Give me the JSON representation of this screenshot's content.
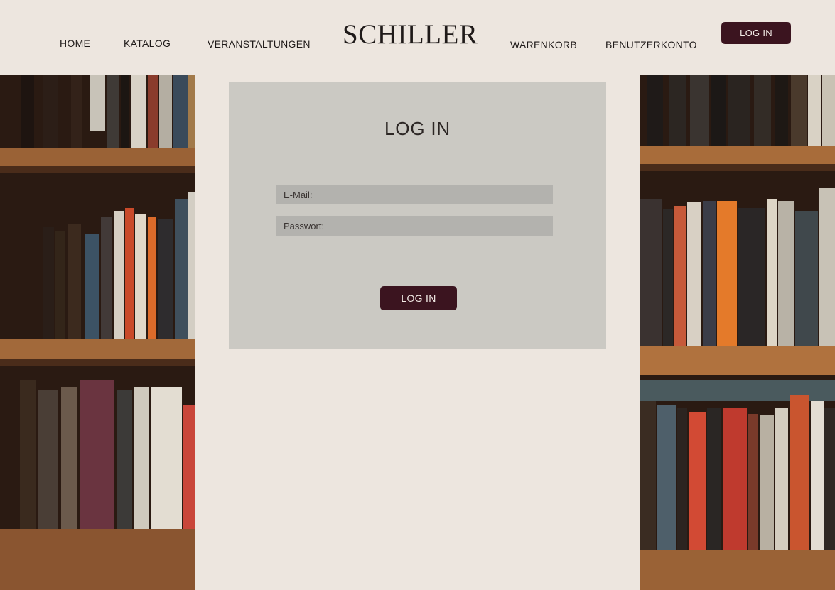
{
  "header": {
    "nav_left": [
      "HOME",
      "KATALOG",
      "VERANSTALTUNGEN"
    ],
    "logo": "SCHILLER",
    "nav_right": [
      "WARENKORB",
      "BENUTZERKONTO"
    ],
    "login_button": "LOG IN"
  },
  "login_form": {
    "title": "LOG IN",
    "email_placeholder": "E-Mail:",
    "password_placeholder": "Passwort:",
    "submit_label": "LOG IN"
  },
  "colors": {
    "background": "#ede6df",
    "card": "#cbc9c3",
    "input": "#b3b2ae",
    "accent": "#3b141f"
  },
  "images": {
    "left_shelf": "bookshelf-photo",
    "right_shelf": "bookshelf-photo"
  }
}
